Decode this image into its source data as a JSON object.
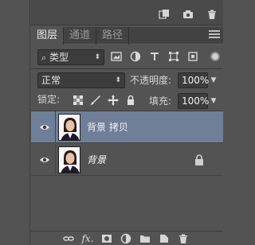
{
  "top_toolbar": {
    "icons": [
      "new-panel-icon",
      "camera-icon",
      "trash-icon"
    ]
  },
  "tabs": [
    {
      "label": "图层",
      "active": true
    },
    {
      "label": "通道",
      "active": false
    },
    {
      "label": "路径",
      "active": false
    }
  ],
  "filter": {
    "kind_label": "类型",
    "icons": [
      "image-filter-icon",
      "adjustment-filter-icon",
      "type-filter-icon",
      "shape-filter-icon",
      "smart-object-filter-icon"
    ]
  },
  "blend": {
    "mode": "正常",
    "opacity_label": "不透明度:",
    "opacity_value": "100%"
  },
  "lock": {
    "label": "锁定:",
    "fill_label": "填充:",
    "fill_value": "100%"
  },
  "layers": [
    {
      "name": "背景 拷贝",
      "selected": true,
      "visible": true,
      "locked": false
    },
    {
      "name": "背景",
      "selected": false,
      "visible": true,
      "locked": true
    }
  ],
  "bottom_bar": {
    "fx_label": "fx."
  },
  "colors": {
    "panel_bg": "#535353",
    "selected_layer": "#6f7f98"
  }
}
